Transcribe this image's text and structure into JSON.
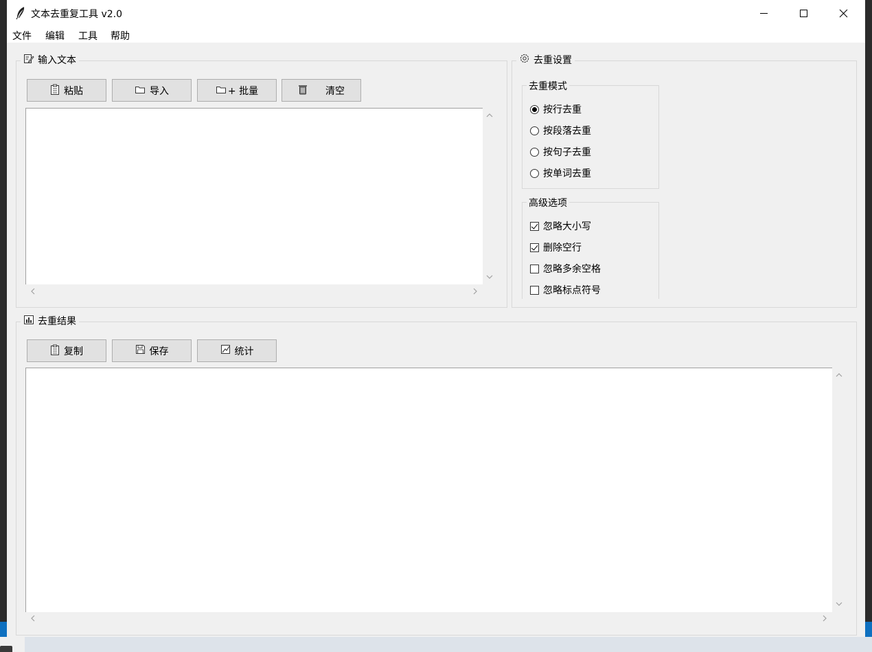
{
  "window": {
    "title": "文本去重复工具 v2.0",
    "icon": "feather-icon"
  },
  "menu": [
    "文件",
    "编辑",
    "工具",
    "帮助"
  ],
  "input_panel": {
    "title": "输入文本",
    "buttons": {
      "paste": "粘贴",
      "import": "导入",
      "batch": "+ 批量",
      "clear": "清空"
    },
    "text": ""
  },
  "settings_panel": {
    "title": "去重设置",
    "mode": {
      "title": "去重模式",
      "options": [
        {
          "label": "按行去重",
          "selected": true
        },
        {
          "label": "按段落去重",
          "selected": false
        },
        {
          "label": "按句子去重",
          "selected": false
        },
        {
          "label": "按单词去重",
          "selected": false
        }
      ]
    },
    "advanced": {
      "title": "高级选项",
      "options": [
        {
          "label": "忽略大小写",
          "checked": true
        },
        {
          "label": "删除空行",
          "checked": true
        },
        {
          "label": "忽略多余空格",
          "checked": false
        },
        {
          "label": "忽略标点符号",
          "checked": false
        }
      ]
    }
  },
  "result_panel": {
    "title": "去重结果",
    "buttons": {
      "copy": "复制",
      "save": "保存",
      "stats": "统计"
    },
    "text": ""
  }
}
